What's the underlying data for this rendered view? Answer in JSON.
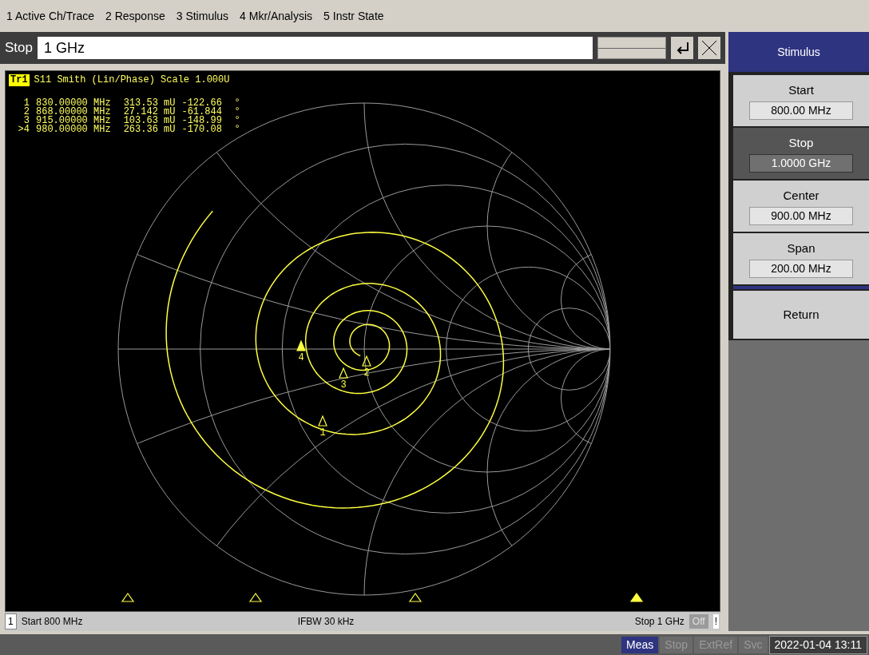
{
  "menu": [
    "1 Active Ch/Trace",
    "2 Response",
    "3 Stimulus",
    "4 Mkr/Analysis",
    "5 Instr State"
  ],
  "entry": {
    "label": "Stop",
    "value": "1 GHz"
  },
  "trace": {
    "tag": "Tr1",
    "title": "S11 Smith (Lin/Phase) Scale 1.000U"
  },
  "markers": [
    {
      "id": "1",
      "label": "1",
      "freq": "830.00000 MHz",
      "mag": "313.53 mU",
      "phase": "-122.66",
      "unit": "°",
      "active": false
    },
    {
      "id": "2",
      "label": "2",
      "freq": "868.00000 MHz",
      "mag": "27.142 mU",
      "phase": "-61.844",
      "unit": "°",
      "active": false
    },
    {
      "id": "3",
      "label": "3",
      "freq": "915.00000 MHz",
      "mag": "103.63 mU",
      "phase": "-148.99",
      "unit": "°",
      "active": false
    },
    {
      "id": ">4",
      "label": "4",
      "freq": "980.00000 MHz",
      "mag": "263.36 mU",
      "phase": "-170.08",
      "unit": "°",
      "active": true
    }
  ],
  "status": {
    "channel": "1",
    "start": "Start 800 MHz",
    "ifbw": "IFBW 30 kHz",
    "stop": "Stop 1 GHz",
    "off": "Off",
    "warning": "!"
  },
  "softkeys": {
    "title": "Stimulus",
    "items": [
      {
        "label": "Start",
        "value": "800.00 MHz",
        "selected": false
      },
      {
        "label": "Stop",
        "value": "1.0000 GHz",
        "selected": true
      },
      {
        "label": "Center",
        "value": "900.00 MHz",
        "selected": false
      },
      {
        "label": "Span",
        "value": "200.00 MHz",
        "selected": false
      }
    ],
    "return": "Return"
  },
  "indicators": [
    {
      "label": "Meas",
      "active": true
    },
    {
      "label": "Stop",
      "active": false
    },
    {
      "label": "ExtRef",
      "active": false
    },
    {
      "label": "Svc",
      "active": false
    }
  ],
  "datetime": "2022-01-04 13:11"
}
